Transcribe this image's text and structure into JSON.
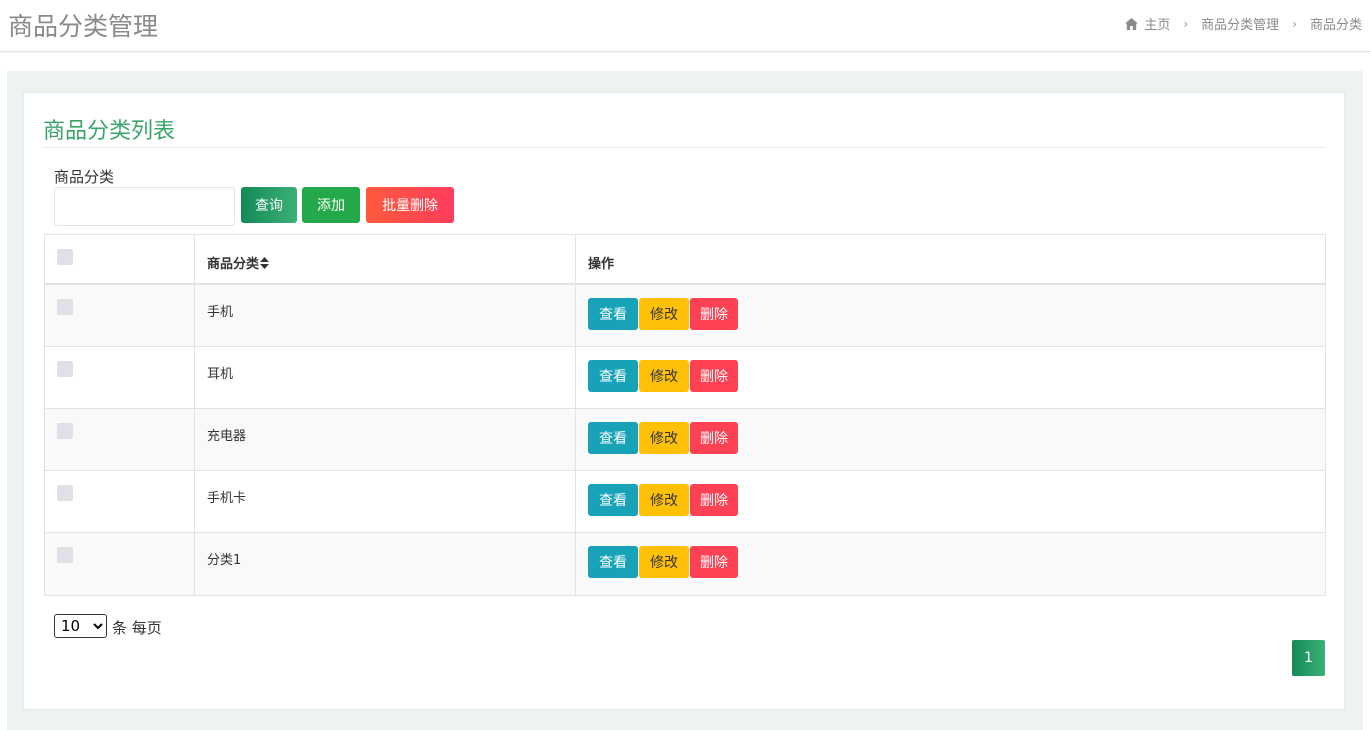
{
  "header": {
    "title": "商品分类管理",
    "breadcrumb": {
      "home": "主页",
      "level1": "商品分类管理",
      "level2": "商品分类"
    }
  },
  "card": {
    "title": "商品分类列表",
    "filter": {
      "label": "商品分类",
      "value": "",
      "placeholder": ""
    },
    "buttons": {
      "query": "查询",
      "add": "添加",
      "batch_delete": "批量删除"
    }
  },
  "table": {
    "headers": [
      "",
      "商品分类",
      "操作"
    ],
    "rows": [
      {
        "name": "手机"
      },
      {
        "name": "耳机"
      },
      {
        "name": "充电器"
      },
      {
        "name": "手机卡"
      },
      {
        "name": "分类1"
      }
    ],
    "actions": {
      "view": "查看",
      "edit": "修改",
      "delete": "删除"
    }
  },
  "pagination": {
    "page_size": "10",
    "page_size_suffix": "条 每页",
    "current_page": "1"
  },
  "colors": {
    "accent_green": "#3aa56a",
    "view": "#17a2b8",
    "edit": "#ffc107",
    "delete": "#ff4154"
  }
}
